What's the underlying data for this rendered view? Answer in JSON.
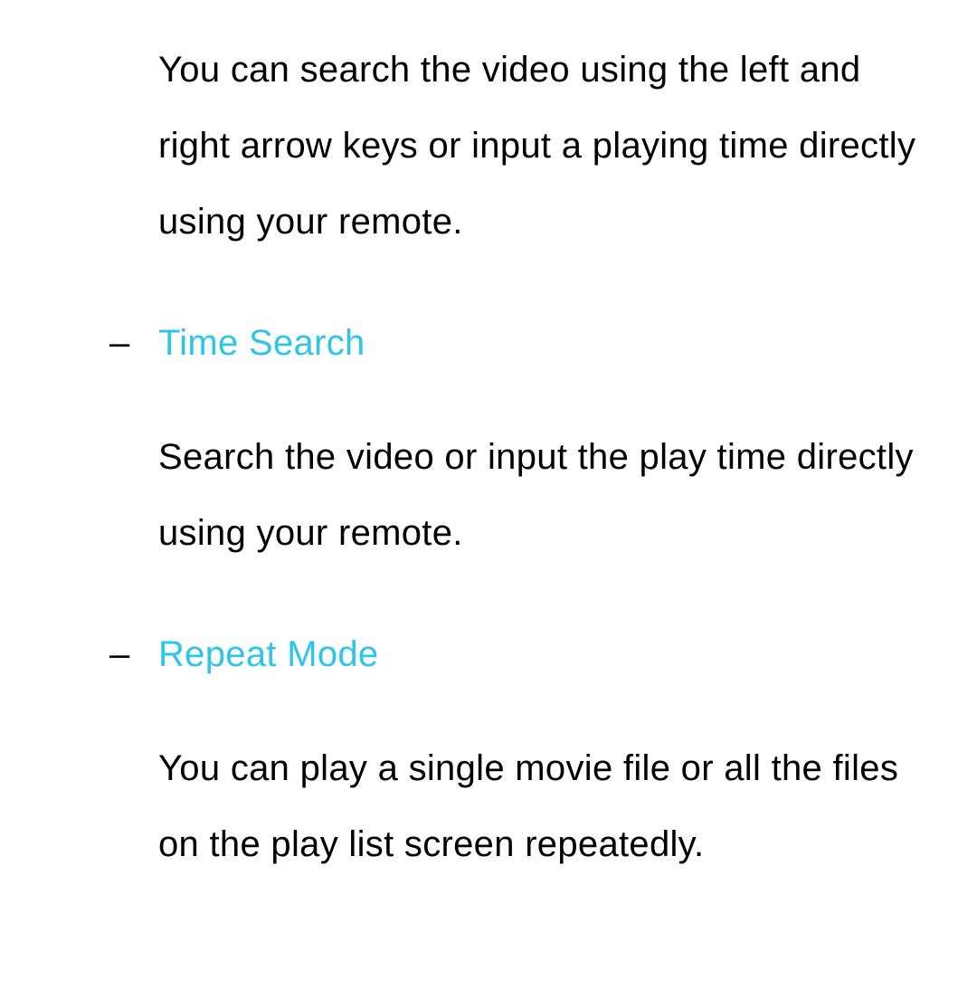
{
  "intro": "You can search the video using the left and right arrow keys or input a playing time directly using your remote.",
  "items": [
    {
      "bullet": "–",
      "title": "Time Search",
      "body": "Search the video or input the play time directly using your remote."
    },
    {
      "bullet": "–",
      "title": "Repeat Mode",
      "body": "You can play a single movie file or all the files on the play list screen repeatedly."
    }
  ]
}
